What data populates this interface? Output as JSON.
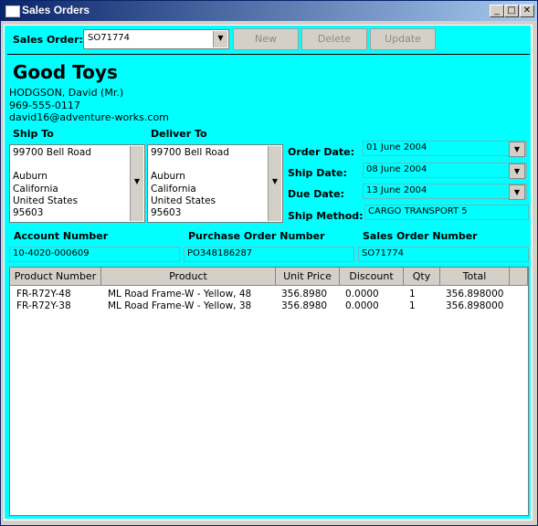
{
  "window": {
    "title": "Sales Orders",
    "controls": [
      "_",
      "□",
      "✕"
    ]
  },
  "toolbar": {
    "sales_order_label": "Sales Order:",
    "sales_order_value": "SO71774",
    "new_label": "New",
    "delete_label": "Delete",
    "update_label": "Update"
  },
  "customer": {
    "company": "Good Toys",
    "contact_name": "HODGSON, David (Mr.)",
    "phone": "969-555-0117",
    "email": "david16@adventure-works.com"
  },
  "ship_to": {
    "label": "Ship To",
    "lines": [
      "99700 Bell Road",
      "",
      "Auburn",
      "California",
      "United States",
      "95603"
    ]
  },
  "deliver_to": {
    "label": "Deliver To",
    "lines": [
      "99700 Bell Road",
      "",
      "Auburn",
      "California",
      "United States",
      "95603"
    ]
  },
  "dates": {
    "order_label": "Order Date:",
    "order_value": "01 June 2004",
    "ship_label": "Ship Date:",
    "ship_value": "08 June 2004",
    "due_label": "Due Date:",
    "due_value": "13 June 2004",
    "method_label": "Ship Method:",
    "method_value": "CARGO TRANSPORT 5"
  },
  "numbers": {
    "account_label": "Account Number",
    "account_value": "10-4020-000609",
    "po_label": "Purchase Order Number",
    "po_value": "PO348186287",
    "so_label": "Sales Order Number",
    "so_value": "SO71774"
  },
  "grid": {
    "headers": [
      "Product Number",
      "Product",
      "Unit Price",
      "Discount",
      "Qty",
      "Total"
    ],
    "rows": [
      [
        "FR-R72Y-48",
        "ML Road Frame-W - Yellow, 48",
        "356.8980",
        "0.0000",
        "1",
        "356.898000"
      ],
      [
        "FR-R72Y-38",
        "ML Road Frame-W - Yellow, 38",
        "356.8980",
        "0.0000",
        "1",
        "356.898000"
      ]
    ]
  },
  "colors": {
    "background": "#00ffff",
    "titlebar": "#0a246a"
  }
}
